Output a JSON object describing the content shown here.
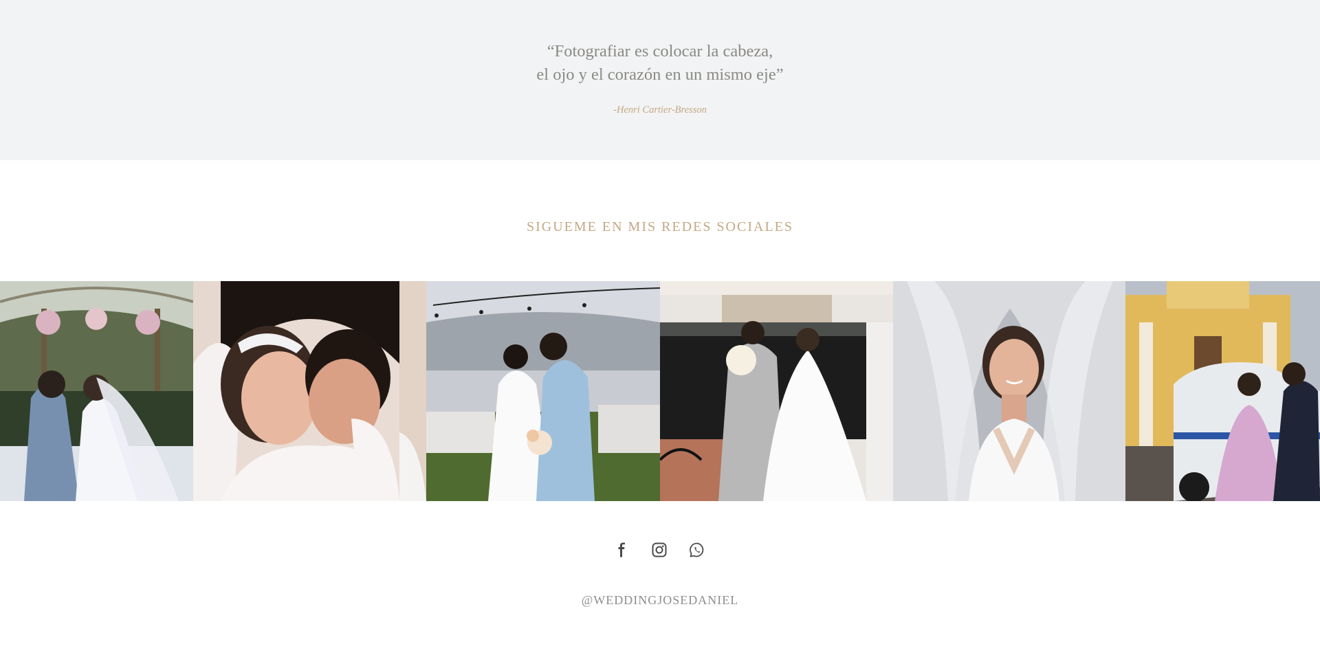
{
  "quote": {
    "line1": "“Fotografiar es colocar la cabeza,",
    "line2": "el ojo y el corazón en un mismo eje”",
    "author": "-Henri Cartier-Bresson"
  },
  "social": {
    "heading": "SIGUEME EN MIS REDES SOCIALES",
    "handle": "@WEDDINGJOSEDANIEL",
    "icons": [
      "facebook-icon",
      "instagram-icon",
      "whatsapp-icon"
    ]
  },
  "gallery": {
    "photos": [
      "wedding-photo-garden-kiss",
      "wedding-photo-closeup-kiss",
      "wedding-photo-lakeside-kiss",
      "wedding-photo-church-exit",
      "wedding-photo-bride-veil",
      "wedding-photo-tuktuk-couple"
    ]
  },
  "colors": {
    "quote_bg": "#f2f3f4",
    "quote_text": "#8a8a84",
    "accent_gold": "#c4a784",
    "icon_gray": "#4a4a4a"
  }
}
